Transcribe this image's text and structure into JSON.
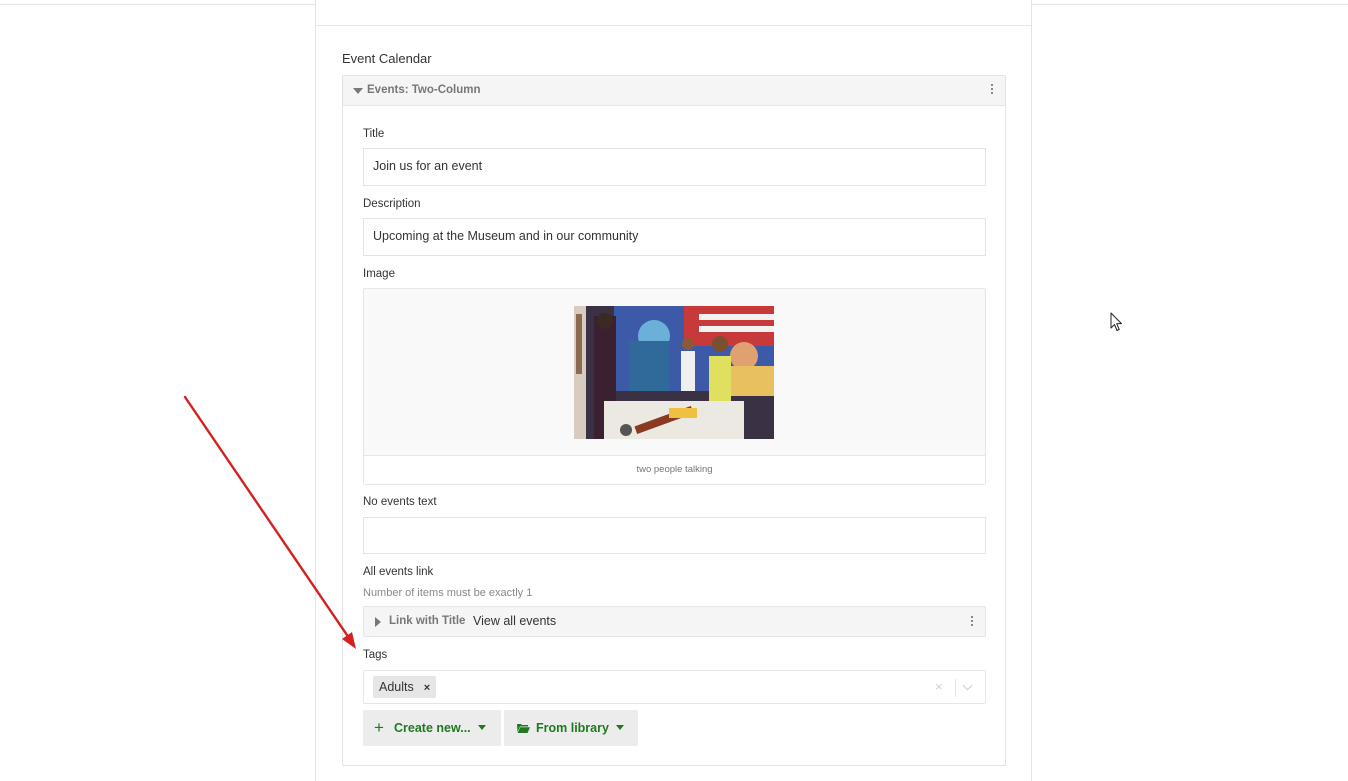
{
  "section": {
    "title": "Event Calendar"
  },
  "card": {
    "title": "Events: Two-Column",
    "fields": {
      "title": {
        "label": "Title",
        "value": "Join us for an event"
      },
      "description": {
        "label": "Description",
        "value": "Upcoming at the Museum and in our community"
      },
      "image": {
        "label": "Image",
        "caption": "two people talking"
      },
      "no_events_text": {
        "label": "No events text",
        "value": ""
      },
      "all_events_link": {
        "label": "All events link",
        "hint": "Number of items must be exactly 1",
        "item": {
          "type": "Link with Title",
          "value": "View all events"
        }
      },
      "tags": {
        "label": "Tags",
        "selected": [
          {
            "label": "Adults",
            "remove": "×"
          }
        ],
        "clear": "×"
      }
    },
    "buttons": {
      "create_new": "Create new...",
      "from_library": "From library",
      "plus": "+"
    }
  },
  "colors": {
    "accent_green": "#1e7a1e",
    "annotation_arrow": "#d42020"
  }
}
